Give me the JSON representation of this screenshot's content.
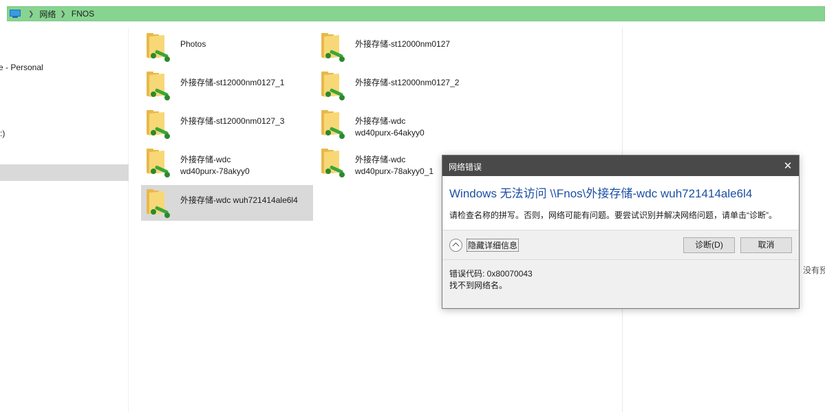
{
  "address_bar": {
    "crumbs": [
      "网络",
      "FNOS"
    ],
    "color": "#87d491"
  },
  "nav": {
    "items": [
      "e - Personal",
      ":)"
    ]
  },
  "files": [
    {
      "name": "Photos"
    },
    {
      "name": "外接存储-st12000nm0127"
    },
    {
      "name": "外接存储-st12000nm0127_1"
    },
    {
      "name": "外接存储-st12000nm0127_2"
    },
    {
      "name": "外接存储-st12000nm0127_3"
    },
    {
      "name": "外接存储-wdc\nwd40purx-64akyy0"
    },
    {
      "name": "外接存储-wdc\nwd40purx-78akyy0"
    },
    {
      "name": "外接存储-wdc\nwd40purx-78akyy0_1"
    },
    {
      "name": "外接存储-wdc wuh721414ale6l4",
      "selected": true
    }
  ],
  "preview": {
    "text": "没有预"
  },
  "dialog": {
    "title": "网络错误",
    "heading": "Windows 无法访问 \\\\Fnos\\外接存储-wdc wuh721414ale6l4",
    "message": "请检查名称的拼写。否则，网络可能有问题。要尝试识别并解决网络问题，请单击“诊断”。",
    "details_label": "隐藏详细信息",
    "diagnose_button": "诊断(D)",
    "cancel_button": "取消",
    "error_code": "错误代码: 0x80070043",
    "error_description": "找不到网络名。",
    "heading_color": "#1c4fa5"
  }
}
